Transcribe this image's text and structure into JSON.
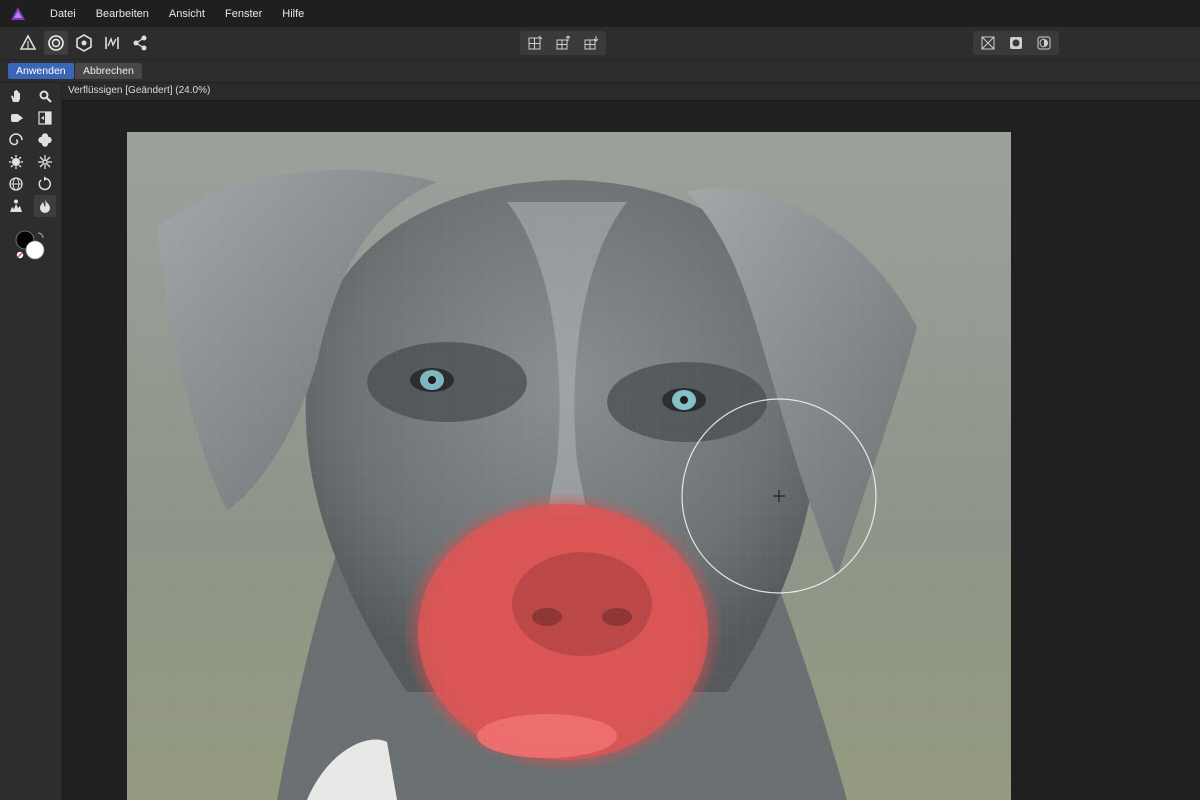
{
  "menu": {
    "items": [
      {
        "label": "Datei"
      },
      {
        "label": "Bearbeiten"
      },
      {
        "label": "Ansicht"
      },
      {
        "label": "Fenster"
      },
      {
        "label": "Hilfe"
      }
    ]
  },
  "toolbar": {
    "left_icons": [
      "pixel-persona-icon",
      "liquify-persona-icon",
      "develop-persona-icon",
      "tone-mapping-persona-icon",
      "export-persona-icon"
    ],
    "center_icons": [
      "mesh-grid-icon",
      "mesh-export-icon",
      "mesh-import-icon"
    ],
    "right_icons": [
      "show-mesh-icon",
      "mask-icon",
      "contrast-icon"
    ]
  },
  "actions": {
    "apply_label": "Anwenden",
    "cancel_label": "Abbrechen"
  },
  "document": {
    "tab_title": "Verflüssigen [Geändert] (24.0%)"
  },
  "colors": {
    "accent": "#3a66b8",
    "nose_mask": "#e05a5a",
    "app_bg": "#1c1c1c",
    "panel_bg": "#2d2d2d"
  },
  "tools": [
    "hand-icon",
    "zoom-icon",
    "push-forward-icon",
    "push-left-icon",
    "twirl-icon",
    "pinch-icon",
    "punch-icon",
    "turbulence-icon",
    "mesh-clone-icon",
    "reconstruct-icon",
    "freeze-icon",
    "thaw-icon"
  ]
}
